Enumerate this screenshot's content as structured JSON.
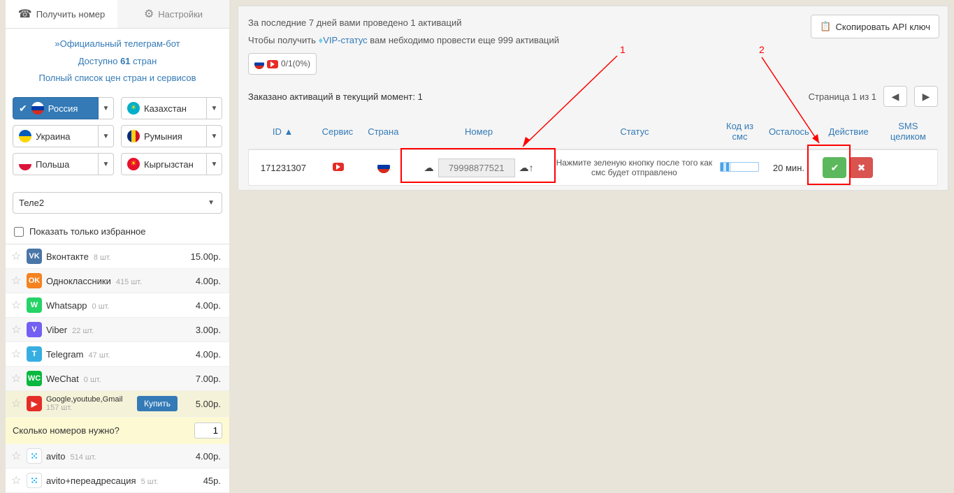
{
  "sidebar": {
    "tabs": {
      "get_number": "Получить номер",
      "settings": "Настройки"
    },
    "links": {
      "tg_bot": "Официальный телеграм-бот",
      "countries_avail_pre": "Доступно ",
      "countries_avail_n": "61",
      "countries_avail_post": " стран",
      "full_price_list": "Полный список цен стран и сервисов"
    },
    "countries": [
      {
        "name": "Россия",
        "flag": "ru",
        "active": true
      },
      {
        "name": "Казахстан",
        "flag": "kz"
      },
      {
        "name": "Украина",
        "flag": "ua"
      },
      {
        "name": "Румыния",
        "flag": "ro"
      },
      {
        "name": "Польша",
        "flag": "pl"
      },
      {
        "name": "Кыргызстан",
        "flag": "kg"
      }
    ],
    "operator_select": "Теле2",
    "show_fav_only": "Показать только избранное",
    "services": [
      {
        "name": "Вконтакте",
        "count": "8 шт.",
        "price": "15.00р.",
        "color": "#4a76a8",
        "abbr": "VK"
      },
      {
        "name": "Одноклассники",
        "count": "415 шт.",
        "price": "4.00р.",
        "color": "#f58220",
        "abbr": "OK"
      },
      {
        "name": "Whatsapp",
        "count": "0 шт.",
        "price": "4.00р.",
        "color": "#25d366",
        "abbr": "W"
      },
      {
        "name": "Viber",
        "count": "22 шт.",
        "price": "3.00р.",
        "color": "#7360f2",
        "abbr": "V"
      },
      {
        "name": "Telegram",
        "count": "47 шт.",
        "price": "4.00р.",
        "color": "#37aee2",
        "abbr": "T"
      },
      {
        "name": "WeChat",
        "count": "0 шт.",
        "price": "7.00р.",
        "color": "#09b83e",
        "abbr": "WC"
      },
      {
        "name": "Google,youtube,Gmail",
        "count": "157 шт.",
        "price": "5.00р.",
        "color": "#e52d27",
        "abbr": "▶",
        "selected": true,
        "buy": "Купить"
      },
      {
        "name": "avito",
        "count": "514 шт.",
        "price": "4.00р.",
        "color": "#ffffff",
        "abbr": "⬤",
        "avito": true
      },
      {
        "name": "avito+переадресация",
        "count": "5 шт.",
        "price": "45р.",
        "color": "#ffffff",
        "abbr": "⬤",
        "avito": true
      }
    ],
    "qty_label": "Сколько номеров нужно?",
    "qty_value": "1"
  },
  "main": {
    "api_button": "Скопировать API ключ",
    "line1": "За последние 7 дней вами проведено 1 активаций",
    "line2_a": "Чтобы получить ",
    "line2_vip": "VIP-статус",
    "line2_b": " вам небходимо провести еще 999 активаций",
    "badge_text": "0/1(0%)",
    "ordered": "Заказано активаций в текущий момент: 1",
    "page_label": "Страница 1 из 1",
    "headers": {
      "id": "ID",
      "service": "Сервис",
      "country": "Страна",
      "number": "Номер",
      "status": "Статус",
      "code": "Код из смс",
      "left": "Осталось",
      "action": "Действие",
      "sms": "SMS целиком"
    },
    "row": {
      "id": "171231307",
      "number": "79998877521",
      "status": "Нажмите зеленую кнопку после того как смс будет отправлено",
      "left": "20 мин."
    },
    "annot1": "1",
    "annot2": "2"
  }
}
